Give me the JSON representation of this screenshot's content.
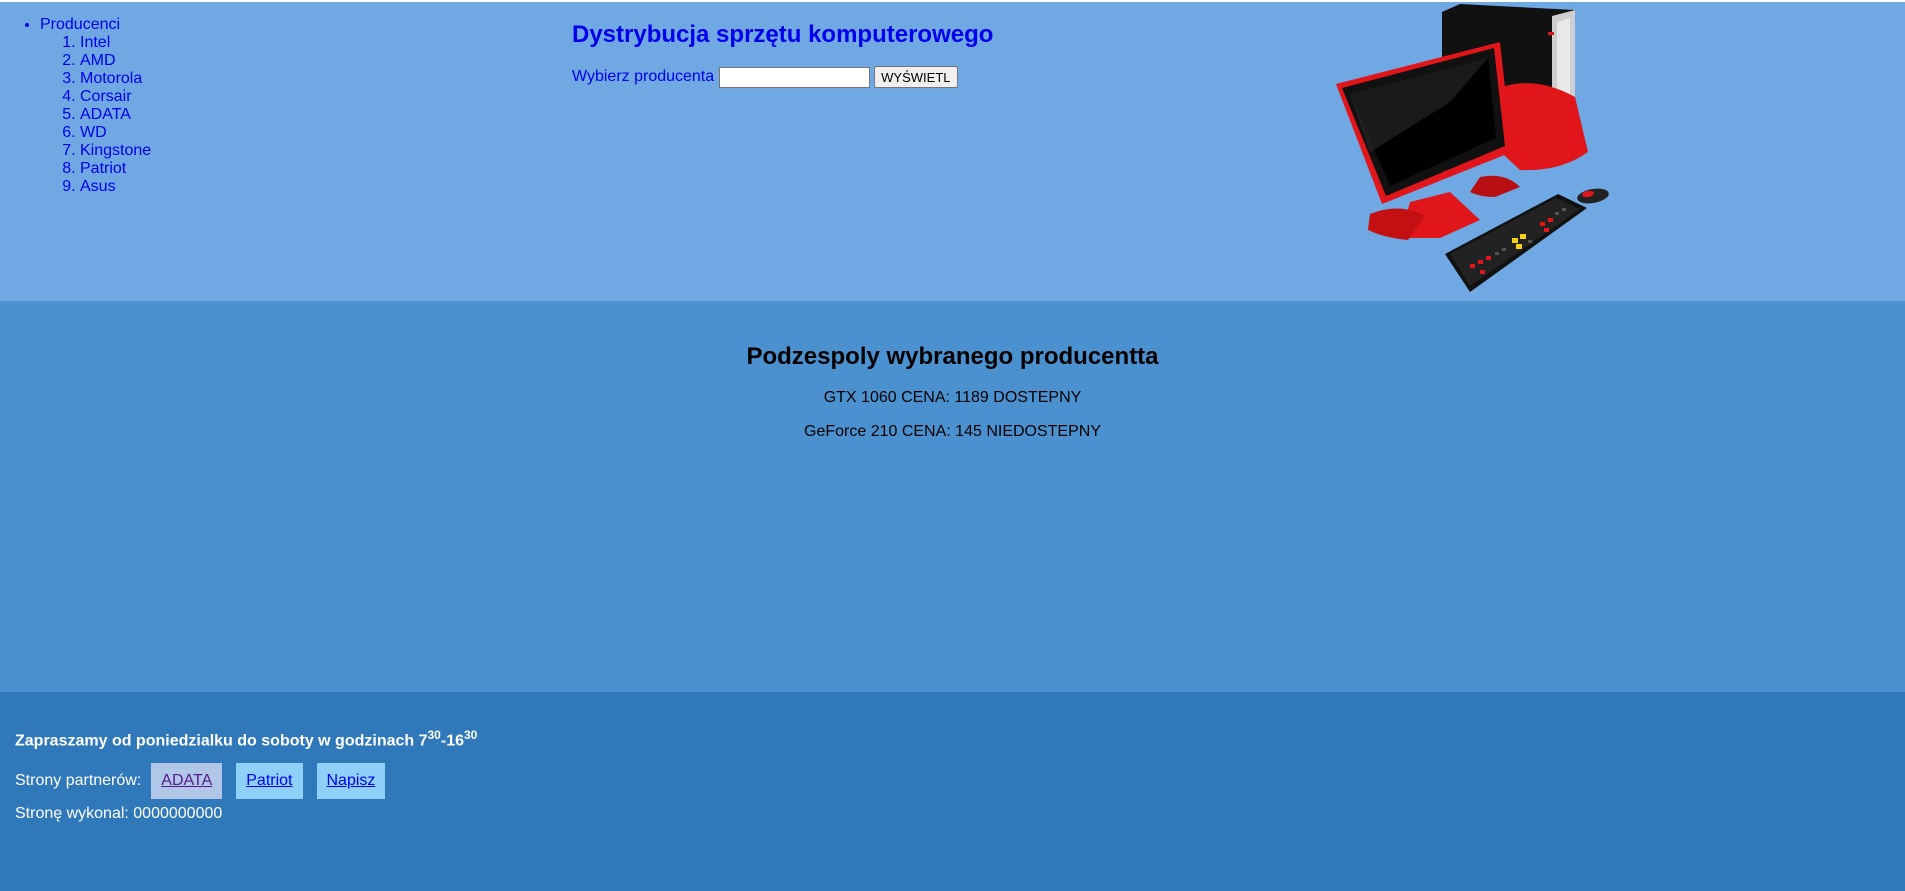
{
  "nav": {
    "top_item": "Producenci",
    "producers": [
      "Intel",
      "AMD",
      "Motorola",
      "Corsair",
      "ADATA",
      "WD",
      "Kingstone",
      "Patriot",
      "Asus"
    ]
  },
  "header": {
    "title": "Dystrybucja sprzętu komputerowego",
    "form_label": "Wybierz producenta",
    "input_value": "",
    "button_label": "WYŚWIETL",
    "image_icon": "computer-set-icon"
  },
  "main": {
    "heading": "Podzespoly wybranego producentta",
    "products": [
      "GTX 1060 CENA: 1189 DOSTEPNY",
      "GeForce 210 CENA: 145 NIEDOSTEPNY"
    ]
  },
  "footer": {
    "hours_text": "Zapraszamy od poniedzialku do soboty w godzinach 7",
    "hours_sup1": "30",
    "hours_dash": "-16",
    "hours_sup2": "30",
    "partners_label": "Strony partnerów:",
    "partner_links": [
      "ADATA",
      "Patriot",
      "Napisz"
    ],
    "author": "Stronę wykonal: 0000000000"
  },
  "colors": {
    "top_bg": "#6fa8e3",
    "main_bg": "#4b91d0",
    "footer_bg": "#2f78ba",
    "link_blue": "#0000ee",
    "accent_red": "#e0161b"
  }
}
